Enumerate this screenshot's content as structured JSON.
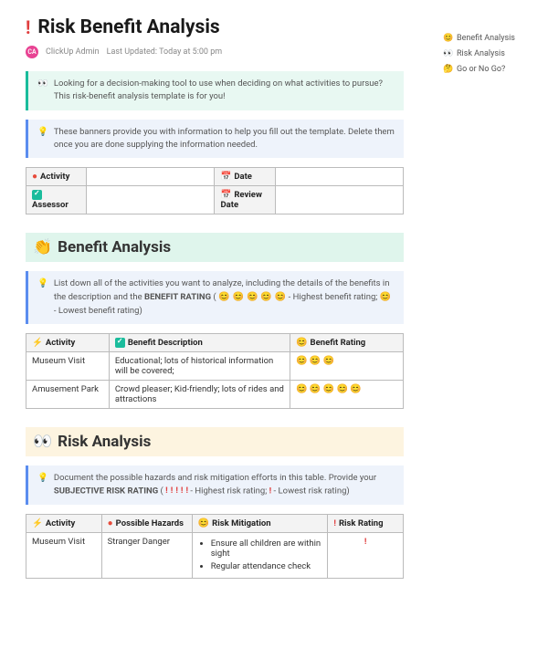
{
  "title": "Risk Benefit Analysis",
  "meta": {
    "author": "ClickUp Admin",
    "updated": "Last Updated: Today at 5:00 pm"
  },
  "sidebar": [
    {
      "icon": "😊",
      "label": "Benefit Analysis"
    },
    {
      "icon": "👀",
      "label": "Risk Analysis"
    },
    {
      "icon": "🤔",
      "label": "Go or No Go?"
    }
  ],
  "banner1": "Looking for a decision-making tool to use when deciding on what activities to pursue? This risk-benefit analysis template is for you!",
  "banner2": "These banners provide you with information to help you fill out the template. Delete them once you are done supplying the information needed.",
  "headerTable": {
    "activity": "Activity",
    "date": "Date",
    "assessor": "Assessor",
    "review": "Review Date"
  },
  "benefit": {
    "heading": "Benefit Analysis",
    "banner_a": "List down all of the activities you want to analyze, including the details of the benefits in the description and the ",
    "banner_b": "BENEFIT RATING",
    "banner_c": " - Highest benefit rating; ",
    "banner_d": " - Lowest benefit rating)",
    "cols": {
      "activity": "Activity",
      "desc": "Benefit Description",
      "rating": "Benefit Rating"
    },
    "rows": [
      {
        "activity": "Museum Visit",
        "desc": "Educational; lots of historical information will be covered;",
        "rating": 3
      },
      {
        "activity": "Amusement Park",
        "desc": "Crowd pleaser; Kid-friendly; lots of rides and attractions",
        "rating": 5
      }
    ]
  },
  "risk": {
    "heading": "Risk Analysis",
    "banner_a": "Document the possible hazards and risk mitigation efforts in this table. Provide your ",
    "banner_b": "SUBJECTIVE RISK RATING",
    "banner_c": " - Highest risk rating; ",
    "banner_d": " - Lowest risk rating)",
    "cols": {
      "activity": "Activity",
      "hazards": "Possible Hazards",
      "mitigation": "Risk Mitigation",
      "rating": "Risk Rating"
    },
    "rows": [
      {
        "activity": "Museum Visit",
        "hazards": "Stranger Danger",
        "mitigation": [
          "Ensure all children are within sight",
          "Regular attendance check"
        ],
        "rating": 1
      }
    ]
  },
  "chart_data": {
    "type": "table",
    "title": "Risk Benefit Analysis",
    "benefit_table": {
      "columns": [
        "Activity",
        "Benefit Description",
        "Benefit Rating (1-5)"
      ],
      "rows": [
        [
          "Museum Visit",
          "Educational; lots of historical information will be covered;",
          3
        ],
        [
          "Amusement Park",
          "Crowd pleaser; Kid-friendly; lots of rides and attractions",
          5
        ]
      ]
    },
    "risk_table": {
      "columns": [
        "Activity",
        "Possible Hazards",
        "Risk Mitigation",
        "Risk Rating (1-5)"
      ],
      "rows": [
        [
          "Museum Visit",
          "Stranger Danger",
          "Ensure all children are within sight; Regular attendance check",
          1
        ]
      ]
    }
  }
}
